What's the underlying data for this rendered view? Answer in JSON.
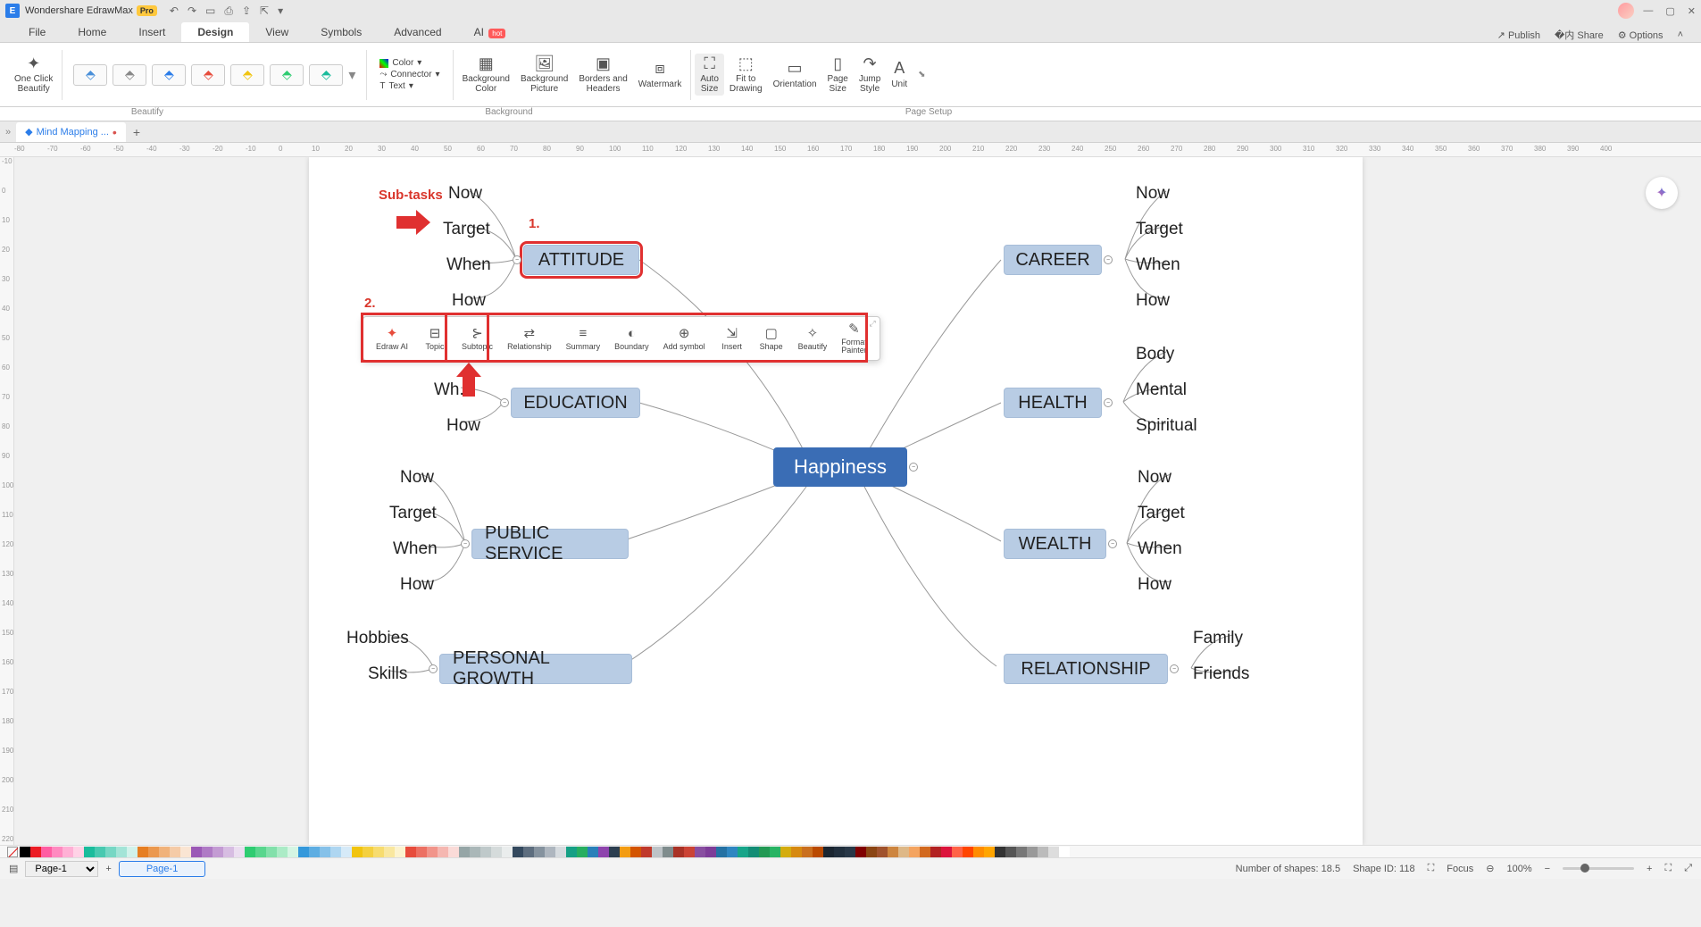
{
  "title_bar": {
    "app_name": "Wondershare EdrawMax",
    "badge": "Pro"
  },
  "menu": {
    "tabs": [
      "File",
      "Home",
      "Insert",
      "Design",
      "View",
      "Symbols",
      "Advanced"
    ],
    "active": "Design",
    "ai_label": "AI",
    "ai_badge": "hot",
    "right": {
      "publish": "Publish",
      "share": "Share",
      "options": "Options"
    }
  },
  "ribbon": {
    "one_click": "One Click\nBeautify",
    "color": "Color",
    "connector": "Connector",
    "text": "Text",
    "bg_color": "Background\nColor",
    "bg_pic": "Background\nPicture",
    "borders": "Borders and\nHeaders",
    "watermark": "Watermark",
    "auto_size": "Auto\nSize",
    "fit": "Fit to\nDrawing",
    "orientation": "Orientation",
    "page_size": "Page\nSize",
    "jump_style": "Jump\nStyle",
    "unit": "Unit",
    "group_beautify": "Beautify",
    "group_background": "Background",
    "group_pagesetup": "Page Setup"
  },
  "doc_tab": {
    "name": "Mind Mapping ..."
  },
  "mindmap": {
    "central": "Happiness",
    "branches": {
      "attitude": {
        "label": "ATTITUDE",
        "leaves": [
          "Now",
          "Target",
          "When",
          "How"
        ]
      },
      "education": {
        "label": "EDUCATION",
        "leaves": [
          "Wh...",
          "How"
        ]
      },
      "public_service": {
        "label": "PUBLIC SERVICE",
        "leaves": [
          "Now",
          "Target",
          "When",
          "How"
        ]
      },
      "personal_growth": {
        "label": "PERSONAL GROWTH",
        "leaves": [
          "Hobbies",
          "Skills"
        ]
      },
      "career": {
        "label": "CAREER",
        "leaves": [
          "Now",
          "Target",
          "When",
          "How"
        ]
      },
      "health": {
        "label": "HEALTH",
        "leaves": [
          "Body",
          "Mental",
          "Spiritual"
        ]
      },
      "wealth": {
        "label": "WEALTH",
        "leaves": [
          "Now",
          "Target",
          "When",
          "How"
        ]
      },
      "relationship": {
        "label": "RELATIONSHIP",
        "leaves": [
          "Family",
          "Friends"
        ]
      }
    }
  },
  "annotations": {
    "subtasks": "Sub-tasks",
    "num1": "1.",
    "num2": "2."
  },
  "float_toolbar": {
    "items": [
      "Edraw AI",
      "Topic",
      "Subtopic",
      "Relationship",
      "Summary",
      "Boundary",
      "Add symbol",
      "Insert",
      "Shape",
      "Beautify",
      "Format\nPainter"
    ]
  },
  "status": {
    "page_selector": "Page-1",
    "page_tab": "Page-1",
    "shapes": "Number of shapes: 18.5",
    "shape_id": "Shape ID: 118",
    "focus": "Focus",
    "zoom": "100%"
  },
  "palette_colors": [
    "#000000",
    "#ec1c24",
    "#ff5da2",
    "#ff8ac0",
    "#ffb0d5",
    "#ffd2e6",
    "#1abc9c",
    "#48c9b0",
    "#76d7c4",
    "#a3e4d7",
    "#d1f2eb",
    "#e67e22",
    "#eb984e",
    "#f0b27a",
    "#f5cba7",
    "#fae5d3",
    "#9b59b6",
    "#af7ac5",
    "#c39bd3",
    "#d7bde2",
    "#ebdef0",
    "#2ecc71",
    "#58d68d",
    "#82e0aa",
    "#abebc6",
    "#d5f5e3",
    "#3498db",
    "#5dade2",
    "#85c1e9",
    "#aed6f1",
    "#d6eaf8",
    "#f1c40f",
    "#f4d03f",
    "#f7dc6f",
    "#f9e79f",
    "#fcf3cf",
    "#e74c3c",
    "#ec7063",
    "#f1948a",
    "#f5b7b1",
    "#fadbd8",
    "#95a5a6",
    "#aab7b8",
    "#bfc9ca",
    "#d5dbdb",
    "#eaeded",
    "#34495e",
    "#5d6d7e",
    "#85929e",
    "#aeb6bf",
    "#d6dbdf",
    "#16a085",
    "#27ae60",
    "#2980b9",
    "#8e44ad",
    "#2c3e50",
    "#f39c12",
    "#d35400",
    "#c0392b",
    "#bdc3c7",
    "#7f8c8d",
    "#a93226",
    "#cb4335",
    "#884ea0",
    "#7d3c98",
    "#2471a3",
    "#2e86c1",
    "#17a589",
    "#138d75",
    "#229954",
    "#28b463",
    "#d4ac0d",
    "#d68910",
    "#ca6f1e",
    "#ba4a00",
    "#1b2631",
    "#212f3d",
    "#283747",
    "#800000",
    "#8b4513",
    "#a0522d",
    "#cd853f",
    "#deb887",
    "#f4a460",
    "#d2691e",
    "#b22222",
    "#dc143c",
    "#ff6347",
    "#ff4500",
    "#ff8c00",
    "#ffa500",
    "#333333",
    "#555555",
    "#777777",
    "#999999",
    "#bbbbbb",
    "#dddddd",
    "#ffffff"
  ]
}
